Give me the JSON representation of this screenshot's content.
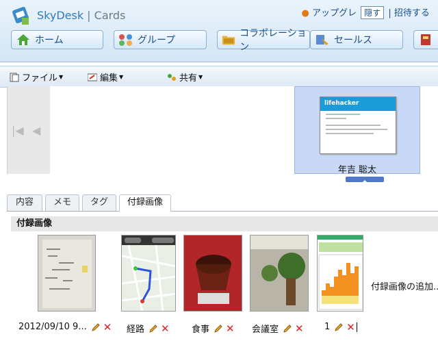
{
  "header": {
    "logo_brand": "SkyDesk",
    "logo_sep": " | ",
    "logo_product": "Cards",
    "upgrade_link": "アップグレ",
    "hide_button": "隠す",
    "invite_link": "招待する"
  },
  "nav": [
    "ホーム",
    "グループ",
    "コラボレーション",
    "セールス"
  ],
  "toolbar": {
    "file": "ファイル",
    "edit": "編集",
    "share": "共有"
  },
  "card": {
    "company": "lifehacker",
    "person_name": "年吉 聡太"
  },
  "tabs": [
    "内容",
    "メモ",
    "タグ",
    "付録画像"
  ],
  "active_tab": "付録画像",
  "section_title": "付録画像",
  "attachments": [
    {
      "caption": "2012/09/10 9..."
    },
    {
      "caption": "経路"
    },
    {
      "caption": "食事"
    },
    {
      "caption": "会議室"
    },
    {
      "caption": "1"
    }
  ],
  "add_attachment": "付録画像の追加..."
}
